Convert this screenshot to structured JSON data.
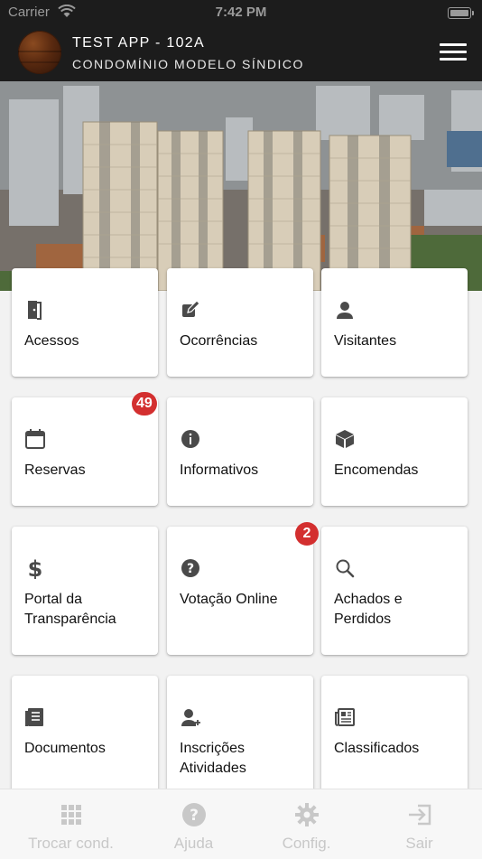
{
  "status_bar": {
    "carrier": "Carrier",
    "time": "7:42 PM"
  },
  "header": {
    "title": "TEST APP - 102A",
    "subtitle": "CONDOMÍNIO MODELO SÍNDICO"
  },
  "menu": {
    "acessos": {
      "label": "Acessos",
      "icon": "door-icon"
    },
    "ocorrencias": {
      "label": "Ocorrências",
      "icon": "edit-icon"
    },
    "visitantes": {
      "label": "Visitantes",
      "icon": "person-icon"
    },
    "reservas": {
      "label": "Reservas",
      "icon": "calendar-icon",
      "badge": "49"
    },
    "informativos": {
      "label": "Informativos",
      "icon": "info-icon"
    },
    "encomendas": {
      "label": "Encomendas",
      "icon": "package-icon"
    },
    "portal": {
      "label": "Portal da Transparência",
      "icon": "dollar-icon"
    },
    "votacao": {
      "label": "Votação Online",
      "icon": "question-icon",
      "badge": "2"
    },
    "achados": {
      "label": "Achados e Perdidos",
      "icon": "search-icon"
    },
    "documentos": {
      "label": "Documentos",
      "icon": "document-icon"
    },
    "inscricoes": {
      "label": "Inscrições Atividades",
      "icon": "person-add-icon"
    },
    "classificados": {
      "label": "Classificados",
      "icon": "newspaper-icon"
    }
  },
  "tabbar": {
    "trocar": "Trocar cond.",
    "ajuda": "Ajuda",
    "config": "Config.",
    "sair": "Sair"
  },
  "colors": {
    "header_bg": "#1c1c1c",
    "badge": "#d32f2f",
    "icon": "#4a4a4a",
    "tab_inactive": "#c8c8c8"
  }
}
